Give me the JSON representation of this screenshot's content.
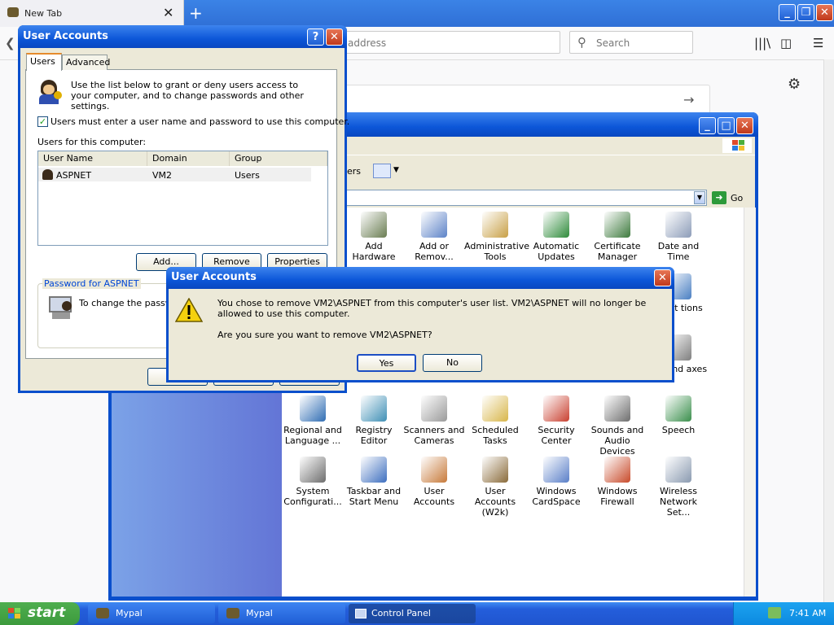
{
  "browser": {
    "tab_title": "New Tab",
    "tab_close": "✕",
    "new_tab": "+",
    "address_placeholder": "address",
    "search_placeholder": "Search",
    "settings_icon": "gear-icon"
  },
  "control_panel": {
    "toolbar_views_label": "ers",
    "go_label": "Go",
    "items": [
      {
        "label": "Add Hardware",
        "icon": "hardware-icon",
        "color": "#6a7d52"
      },
      {
        "label": "Add or Remov...",
        "icon": "add-remove-icon",
        "color": "#5c82c7"
      },
      {
        "label": "Administrative Tools",
        "icon": "admin-tools-icon",
        "color": "#c8a046"
      },
      {
        "label": "Automatic Updates",
        "icon": "windows-update-icon",
        "color": "#2e8b3a"
      },
      {
        "label": "Certificate Manager",
        "icon": "certificate-icon",
        "color": "#3d7a3d"
      },
      {
        "label": "Date and Time",
        "icon": "clock-icon",
        "color": "#8c9cb8"
      },
      {
        "label": "ernet tions",
        "icon": "internet-options-icon",
        "color": "#4a7fc2"
      },
      {
        "label": "ers and axes",
        "icon": "printer-icon",
        "color": "#7f7f7f"
      },
      {
        "label": "Regional and Language ...",
        "icon": "globe-icon",
        "color": "#2f6db3"
      },
      {
        "label": "Registry Editor",
        "icon": "registry-icon",
        "color": "#3f8fb5"
      },
      {
        "label": "Scanners and Cameras",
        "icon": "scanner-icon",
        "color": "#9a9a9a"
      },
      {
        "label": "Scheduled Tasks",
        "icon": "folder-clock-icon",
        "color": "#d8b64a"
      },
      {
        "label": "Security Center",
        "icon": "shield-icon",
        "color": "#c94030"
      },
      {
        "label": "Sounds and Audio Devices",
        "icon": "speaker-icon",
        "color": "#6e6e6e"
      },
      {
        "label": "Speech",
        "icon": "speech-icon",
        "color": "#3a8f4c"
      },
      {
        "label": "System Configurati...",
        "icon": "system-config-icon",
        "color": "#6d6d6d"
      },
      {
        "label": "Taskbar and Start Menu",
        "icon": "taskbar-icon",
        "color": "#3e6fbf"
      },
      {
        "label": "User Accounts",
        "icon": "users-icon",
        "color": "#c77a3a"
      },
      {
        "label": "User Accounts (W2k)",
        "icon": "user-key-icon",
        "color": "#8a6b3a"
      },
      {
        "label": "Windows CardSpace",
        "icon": "cardspace-icon",
        "color": "#5a7fc8"
      },
      {
        "label": "Windows Firewall",
        "icon": "firewall-icon",
        "color": "#c84a2a"
      },
      {
        "label": "Wireless Network Set...",
        "icon": "wireless-icon",
        "color": "#8a9ab0"
      }
    ]
  },
  "user_accounts": {
    "title": "User Accounts",
    "tabs": [
      "Users",
      "Advanced"
    ],
    "intro": "Use the list below to grant or deny users access to your computer, and to change passwords and other settings.",
    "checkbox_label": "Users must enter a user name and password to use this computer.",
    "checkbox_checked": true,
    "list_label": "Users for this computer:",
    "columns": [
      "User Name",
      "Domain",
      "Group"
    ],
    "rows": [
      {
        "user": "ASPNET",
        "domain": "VM2",
        "group": "Users"
      }
    ],
    "buttons": {
      "add": "Add...",
      "remove": "Remove",
      "properties": "Properties"
    },
    "password_group": "Password for ASPNET",
    "password_text": "To change the passwo"
  },
  "dialog": {
    "title": "User Accounts",
    "message": "You chose to remove VM2\\ASPNET from this computer's user list. VM2\\ASPNET will no longer be allowed to use this computer.",
    "question": "Are you sure you want to remove VM2\\ASPNET?",
    "yes": "Yes",
    "no": "No"
  },
  "taskbar": {
    "start": "start",
    "tasks": [
      "Mypal",
      "Mypal",
      "Control Panel"
    ],
    "clock": "7:41 AM"
  }
}
